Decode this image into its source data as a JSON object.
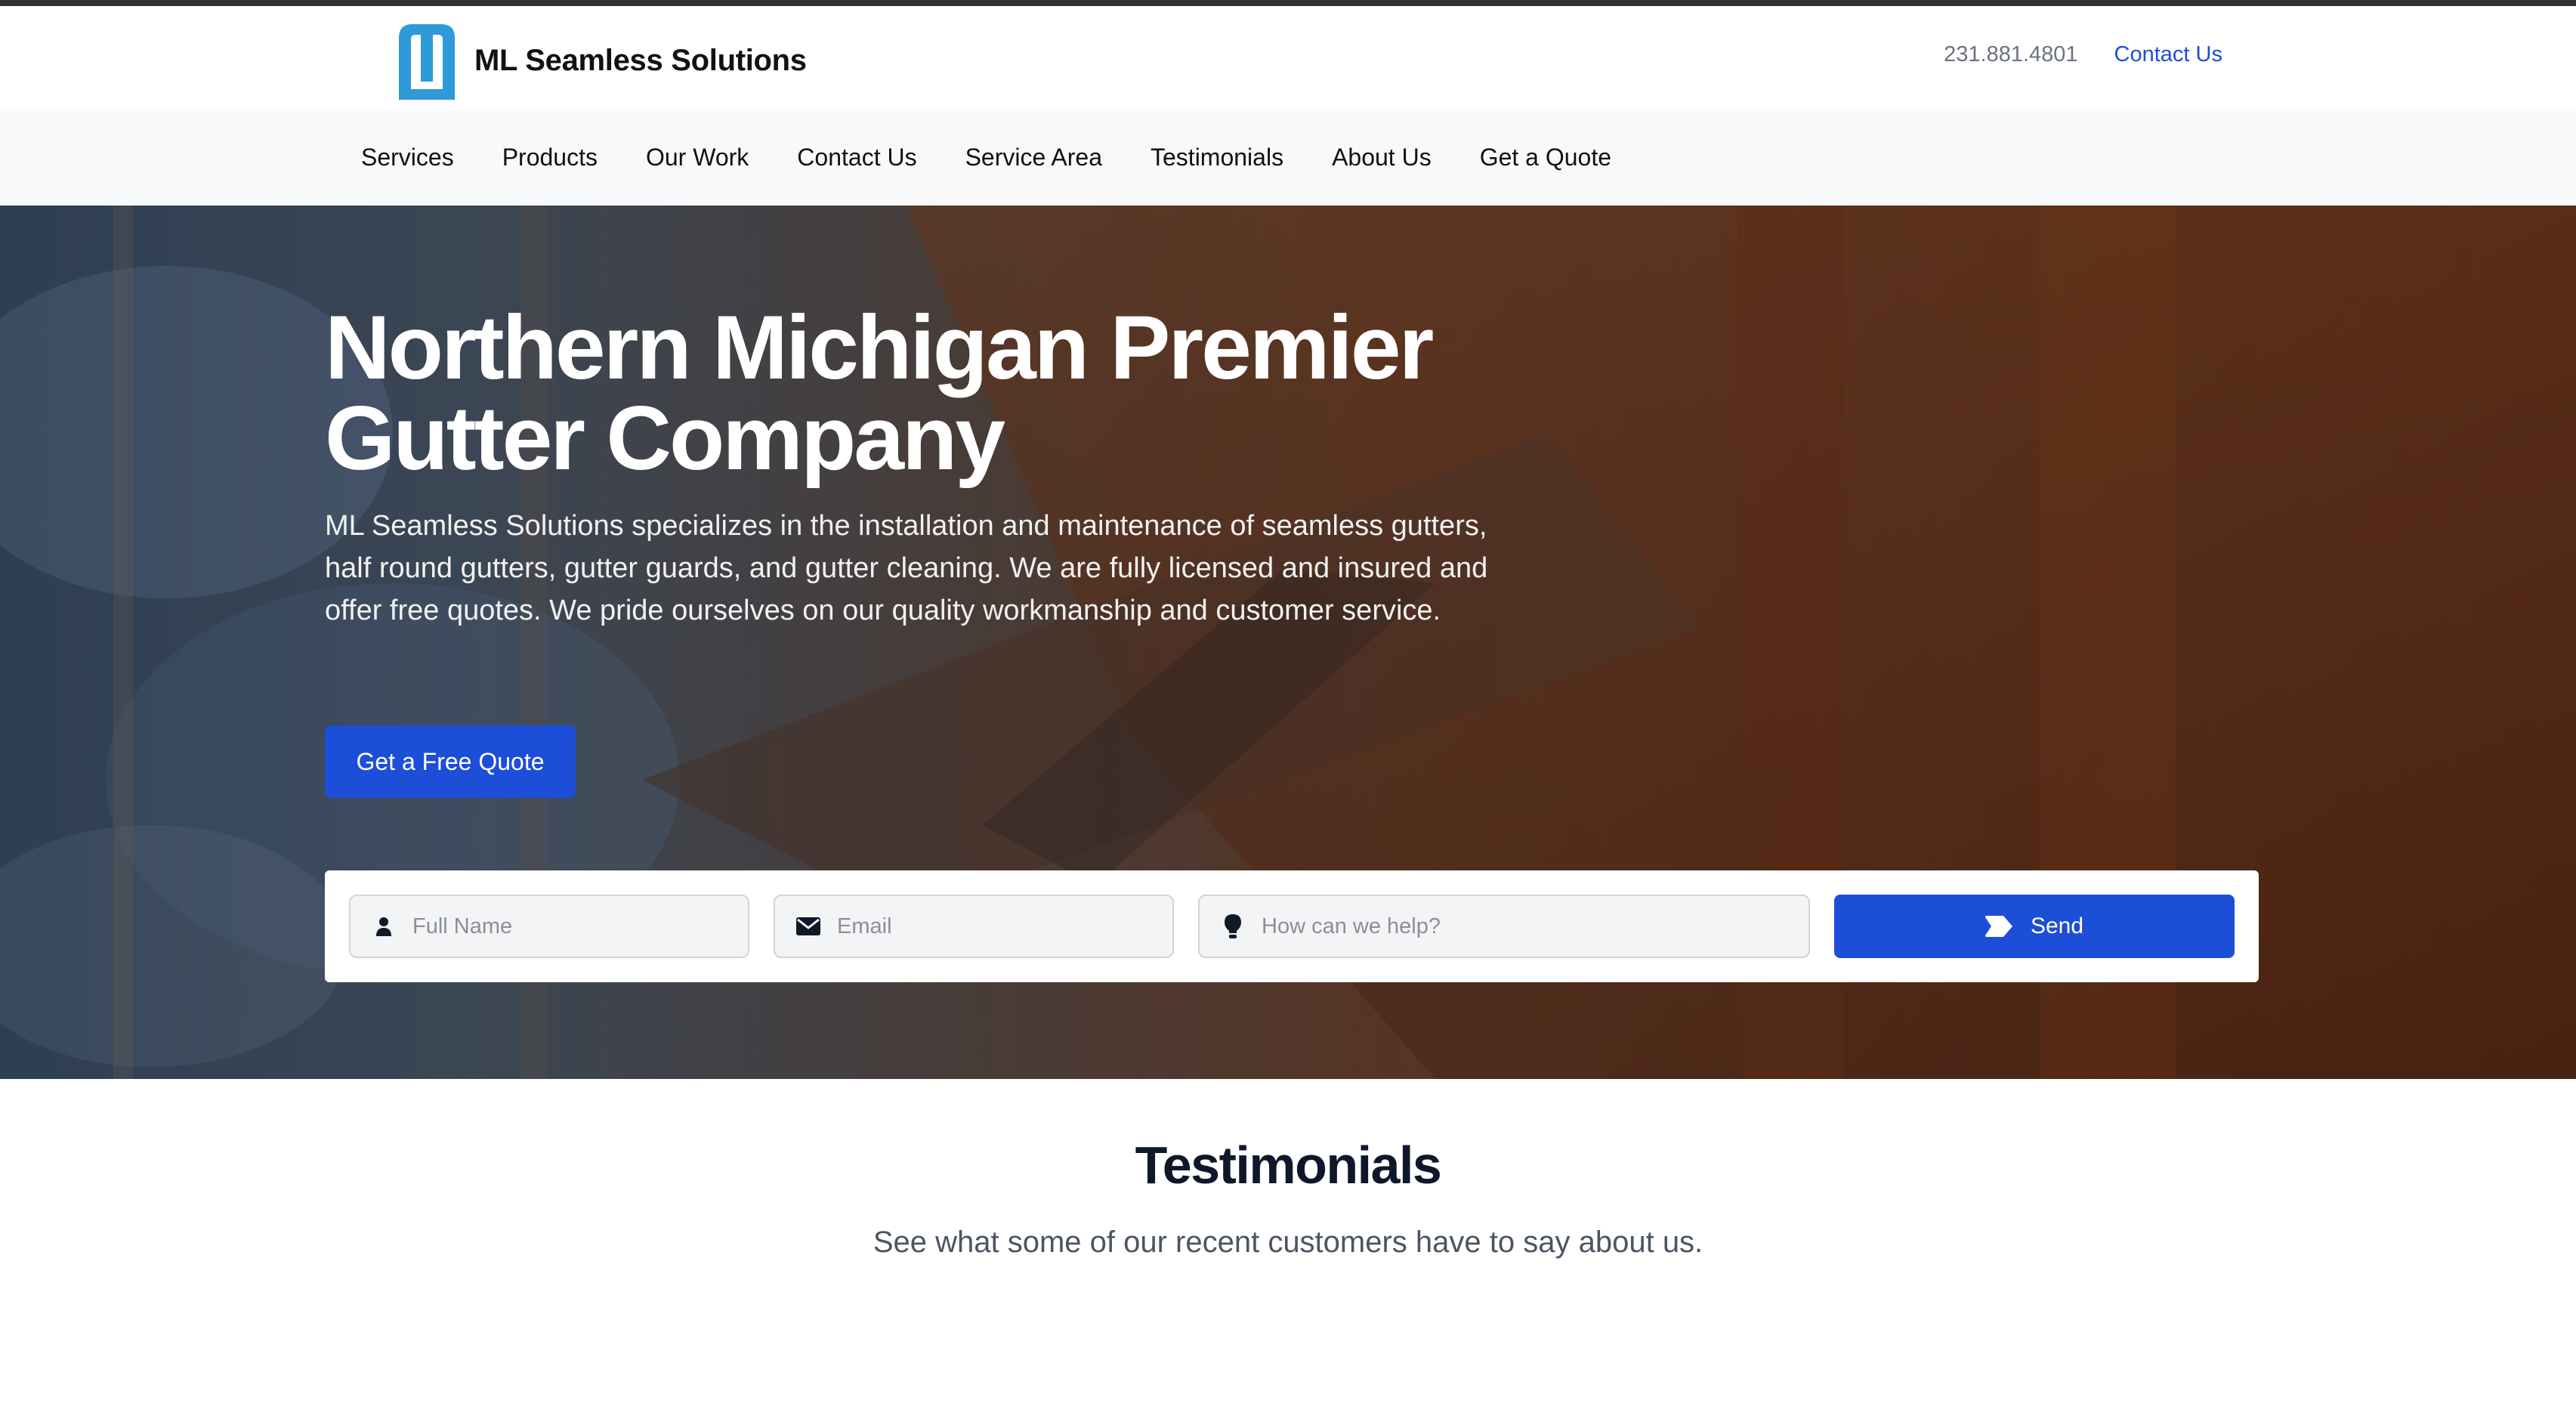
{
  "brand": {
    "name": "ML Seamless Solutions",
    "logo_icon": "m-logo-icon",
    "logo_color": "#2f9ad8"
  },
  "header": {
    "phone": "231.881.4801",
    "contact_link": "Contact Us"
  },
  "nav": {
    "items": [
      {
        "label": "Services"
      },
      {
        "label": "Products"
      },
      {
        "label": "Our Work"
      },
      {
        "label": "Contact Us"
      },
      {
        "label": "Service Area"
      },
      {
        "label": "Testimonials"
      },
      {
        "label": "About Us"
      },
      {
        "label": "Get a Quote"
      }
    ]
  },
  "hero": {
    "title": "Northern Michigan Premier Gutter Company",
    "description": "ML Seamless Solutions specializes in the installation and maintenance of seamless gutters, half round gutters, gutter guards, and gutter cleaning. We are fully licensed and insured and offer free quotes. We pride ourselves on our quality workmanship and customer service.",
    "cta_label": "Get a Free Quote"
  },
  "form": {
    "name_placeholder": "Full Name",
    "name_icon": "user-icon",
    "email_placeholder": "Email",
    "email_icon": "envelope-icon",
    "help_placeholder": "How can we help?",
    "help_icon": "lightbulb-icon",
    "send_label": "Send",
    "send_icon": "tag-icon"
  },
  "testimonials": {
    "title": "Testimonials",
    "subtitle": "See what some of our recent customers have to say about us."
  },
  "colors": {
    "accent": "#1d4ed8",
    "topbar": "#2f3135",
    "nav_bg": "#f8f9fa"
  }
}
